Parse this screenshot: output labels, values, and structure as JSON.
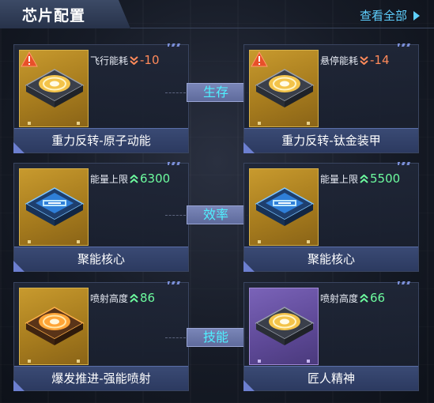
{
  "header": {
    "title": "芯片配置",
    "view_all": "查看全部"
  },
  "rows": [
    {
      "category": "生存",
      "left": {
        "stat_label": "飞行能耗",
        "stat_value": "-10",
        "trend": "down",
        "name": "重力反转-原子动能",
        "rarity": "gold",
        "warning": true,
        "chip": "gold-ring"
      },
      "right": {
        "stat_label": "悬停能耗",
        "stat_value": "-14",
        "trend": "down",
        "name": "重力反转-钛金装甲",
        "rarity": "gold",
        "warning": true,
        "chip": "gold-ring"
      }
    },
    {
      "category": "效率",
      "left": {
        "stat_label": "能量上限",
        "stat_value": "6300",
        "trend": "up",
        "name": "聚能核心",
        "rarity": "gold",
        "warning": false,
        "chip": "blue-core"
      },
      "right": {
        "stat_label": "能量上限",
        "stat_value": "5500",
        "trend": "up",
        "name": "聚能核心",
        "rarity": "gold",
        "warning": false,
        "chip": "blue-core"
      }
    },
    {
      "category": "技能",
      "left": {
        "stat_label": "喷射高度",
        "stat_value": "86",
        "trend": "up",
        "name": "爆发推进-强能喷射",
        "rarity": "gold",
        "warning": false,
        "chip": "orange-ring"
      },
      "right": {
        "stat_label": "喷射高度",
        "stat_value": "66",
        "trend": "up",
        "name": "匠人精神",
        "rarity": "purple",
        "warning": false,
        "chip": "gold-ring"
      }
    }
  ],
  "colors": {
    "accent_blue": "#5fd0ff",
    "category_text": "#4ff0ff",
    "negative": "#ff8a5a",
    "positive": "#6dfc9f",
    "gold_frame": "#c89a2e",
    "purple_frame": "#7a63b8"
  }
}
